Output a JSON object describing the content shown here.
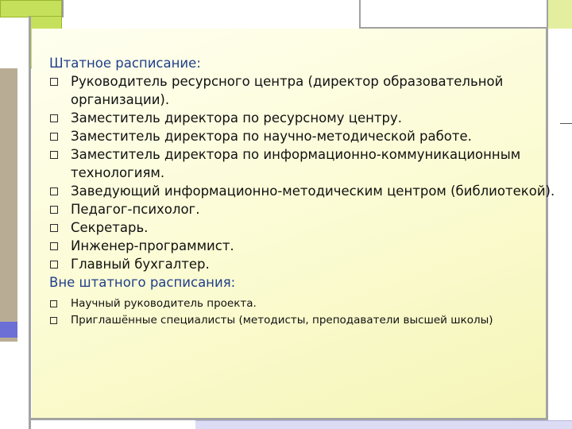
{
  "heading_staff": "Штатное расписание:",
  "staff_items": [
    "Руководитель ресурсного центра (директор образовательной организации).",
    "Заместитель директора по ресурсному центру.",
    "Заместитель директора по научно-методической работе.",
    "Заместитель директора по информационно-коммуникационным технологиям.",
    "Заведующий информационно-методическим центром (библиотекой).",
    "Педагог-психолог.",
    "Секретарь.",
    "Инженер-программист.",
    "Главный бухгалтер."
  ],
  "heading_nonstaff": "Вне штатного расписания:",
  "nonstaff_items": [
    "Научный руководитель проекта.",
    "Приглашённые специалисты (методисты, преподаватели высшей школы)"
  ],
  "bullet_icon": "hollow-square-bullet",
  "colors": {
    "heading": "#1f3f8a",
    "panel": "#fbfbd2",
    "accent_green": "#c5e05a",
    "accent_tan": "#b8ad94",
    "accent_blue": "#6b6fd6",
    "accent_lavender": "#dcdcf4"
  }
}
